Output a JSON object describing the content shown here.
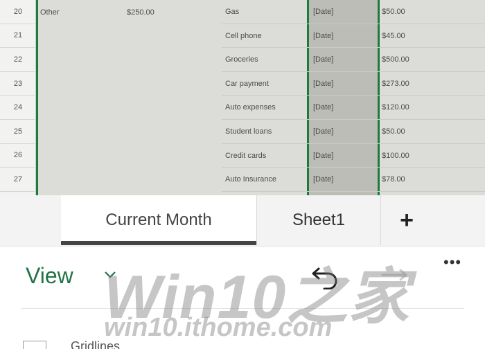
{
  "sheet": {
    "rows": [
      {
        "num": "20",
        "item": "Gas",
        "date": "[Date]",
        "amount": "$50.00"
      },
      {
        "num": "21",
        "item": "Cell phone",
        "date": "[Date]",
        "amount": "$45.00"
      },
      {
        "num": "22",
        "item": "Groceries",
        "date": "[Date]",
        "amount": "$500.00"
      },
      {
        "num": "23",
        "item": "Car payment",
        "date": "[Date]",
        "amount": "$273.00"
      },
      {
        "num": "24",
        "item": "Auto expenses",
        "date": "[Date]",
        "amount": "$120.00"
      },
      {
        "num": "25",
        "item": "Student loans",
        "date": "[Date]",
        "amount": "$50.00"
      },
      {
        "num": "26",
        "item": "Credit cards",
        "date": "[Date]",
        "amount": "$100.00"
      },
      {
        "num": "27",
        "item": "Auto Insurance",
        "date": "[Date]",
        "amount": "$78.00"
      }
    ],
    "left_label": "Other",
    "left_amount": "$250.00",
    "colors": {
      "green_border": "#1f7a3a",
      "cell_bg": "#dcdcd8",
      "date_bg": "#bdbdb8"
    }
  },
  "tabs": [
    {
      "label": "Current Month",
      "active": true
    },
    {
      "label": "Sheet1",
      "active": false
    }
  ],
  "add_sheet_label": "+",
  "ribbon": {
    "view_label": "View",
    "more_label": "•••",
    "partial_item": "Gridlines",
    "accent": "#217346"
  },
  "watermark": {
    "brand": "Win10之家",
    "url": "win10.ithome.com"
  }
}
